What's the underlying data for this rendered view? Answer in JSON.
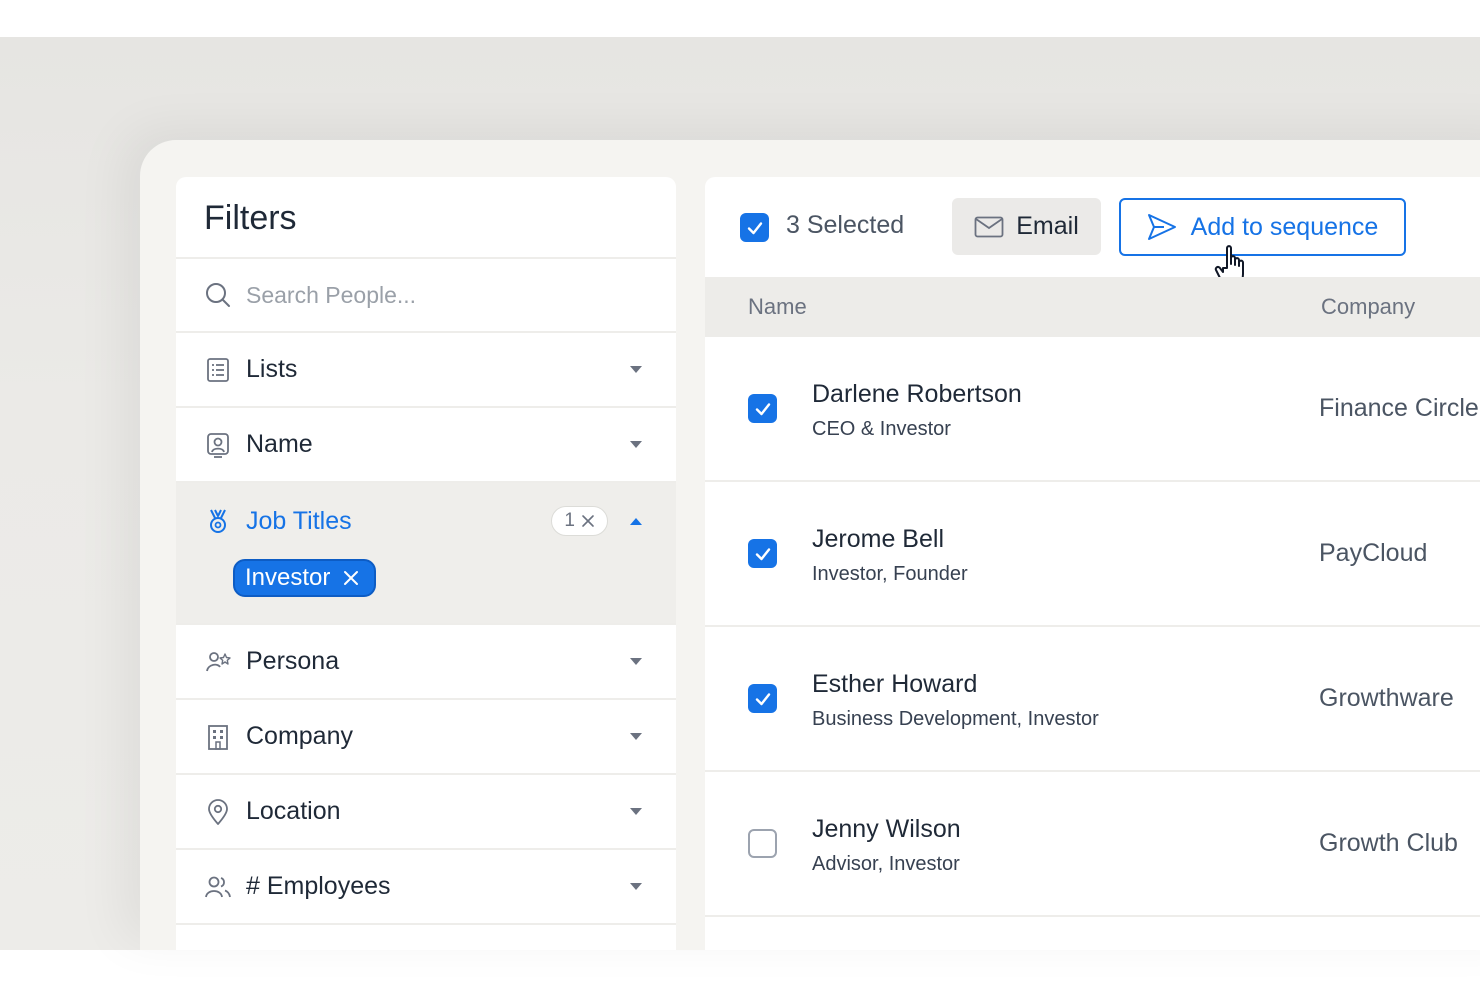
{
  "filters": {
    "title": "Filters",
    "search_placeholder": "Search People...",
    "items": [
      {
        "label": "Lists",
        "icon": "list-icon"
      },
      {
        "label": "Name",
        "icon": "contact-card-icon"
      },
      {
        "label": "Job Titles",
        "icon": "medal-icon",
        "count": "1",
        "expanded": true,
        "chips": [
          "Investor"
        ]
      },
      {
        "label": "Persona",
        "icon": "persona-star-icon"
      },
      {
        "label": "Company",
        "icon": "building-icon"
      },
      {
        "label": "Location",
        "icon": "map-pin-icon"
      },
      {
        "label": "# Employees",
        "icon": "users-icon"
      }
    ]
  },
  "toolbar": {
    "selected_text": "3 Selected",
    "email_label": "Email",
    "sequence_label": "Add to sequence"
  },
  "table": {
    "columns": [
      "Name",
      "Company"
    ],
    "rows": [
      {
        "name": "Darlene Robertson",
        "title": "CEO & Investor",
        "company": "Finance Circle",
        "checked": true
      },
      {
        "name": "Jerome Bell",
        "title": "Investor, Founder",
        "company": "PayCloud",
        "checked": true
      },
      {
        "name": "Esther Howard",
        "title": "Business Development, Investor",
        "company": "Growthware",
        "checked": true
      },
      {
        "name": "Jenny Wilson",
        "title": "Advisor, Investor",
        "company": "Growth Club",
        "checked": false
      }
    ]
  },
  "colors": {
    "accent": "#1673e6",
    "panel": "#ffffff",
    "muted_text": "#6b7280"
  }
}
